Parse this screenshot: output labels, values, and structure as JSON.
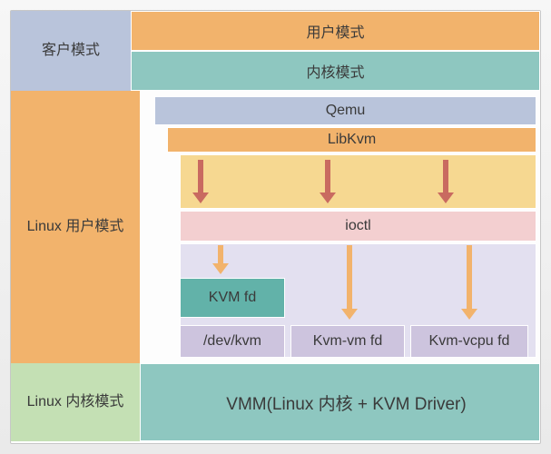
{
  "row1": {
    "side": "客户模式",
    "top": "用户模式",
    "bottom": "内核模式"
  },
  "row2": {
    "side": "Linux 用户模式",
    "qemu": "Qemu",
    "libkvm": "LibKvm",
    "ioctl": "ioctl",
    "kvmfd": "KVM fd",
    "devkvm": "/dev/kvm",
    "vmfd": "Kvm-vm fd",
    "vcpufd": "Kvm-vcpu fd"
  },
  "row3": {
    "side": "Linux 内核模式",
    "main": "VMM(Linux  内核 + KVM Driver)"
  }
}
